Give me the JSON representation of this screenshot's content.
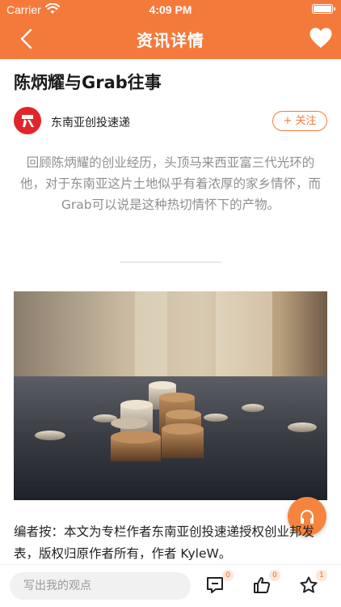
{
  "status_bar": {
    "carrier": "Carrier",
    "time": "4:09 PM"
  },
  "nav": {
    "title": "资讯详情"
  },
  "article": {
    "title": "陈炳耀与Grab往事",
    "author": "东南亚创投速递",
    "follow_label": "+ 关注",
    "summary": "回顾陈炳耀的创业经历，头顶马来西亚富三代光环的他，对于东南亚这片土地似乎有着浓厚的家乡情怀，而Grab可以说是这种热切情怀下的产物。",
    "editor_note": "编者按：本文为专栏作者东南亚创投速递授权创业邦发表，版权归原作者所有，作者 KyleW。"
  },
  "bottom_bar": {
    "comment_placeholder": "写出我的观点",
    "comment_count": "0",
    "like_count": "0",
    "favorite_count": "1"
  },
  "colors": {
    "accent": "#f47a3c",
    "avatar": "#e1262b"
  },
  "icons": [
    "wifi-icon",
    "battery-icon",
    "back-chevron-icon",
    "heart-icon",
    "headphones-icon",
    "comment-icon",
    "thumbs-up-icon",
    "star-icon"
  ]
}
